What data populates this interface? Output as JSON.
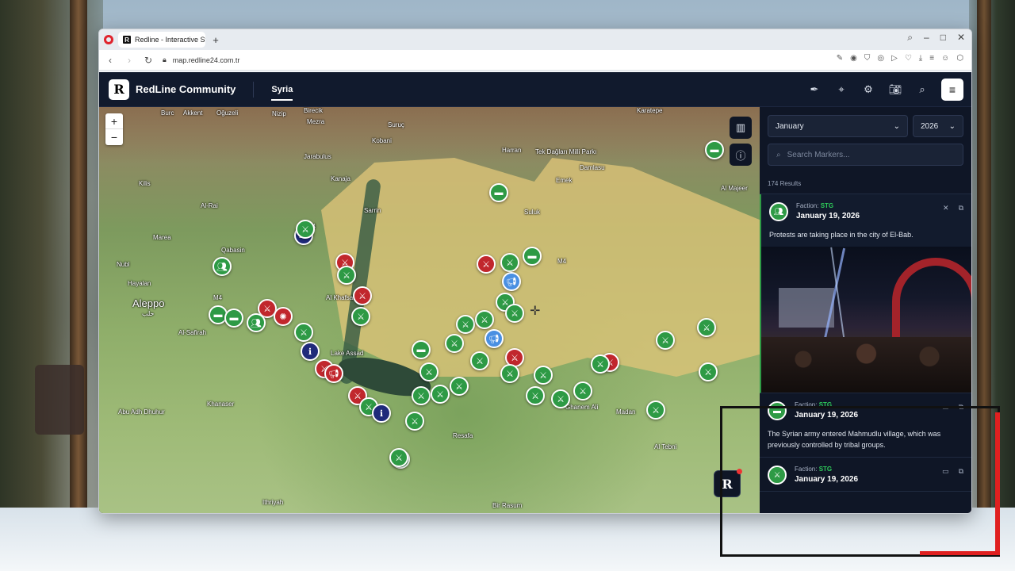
{
  "browser": {
    "tab_title": "Redline - Interactive Strat",
    "url": "map.redline24.com.tr"
  },
  "app": {
    "logo": "R",
    "title": "RedLine Community",
    "nav_tab": "Syria"
  },
  "map": {
    "zoom_in": "+",
    "zoom_out": "−",
    "places": {
      "aleppo": "Aleppo",
      "aleppo_ar": "حلب",
      "kobani": "Kobani",
      "suruc": "Suruç",
      "harran": "Harran",
      "tek_dagi": "Tek Dağları Milli Parkı",
      "damlasu": "Damlasu",
      "emek": "Emek",
      "karatepe": "Karatepe",
      "birecik": "Birecik",
      "nizip": "Nizip",
      "mezra": "Mezra",
      "akkent": "Akkent",
      "oguzeli": "Oğuzeli",
      "burc": "Burc",
      "jarabulus": "Jarabulus",
      "kanaja": "Kanaja",
      "sarrin": "Sarrin",
      "suluk": "Suluk",
      "al_majeer": "Al Majeer",
      "kilis": "Kilis",
      "al_rai": "Al-Rai",
      "marea": "Marea",
      "qabasin": "Qabasin",
      "nubl": "Nubl",
      "hayalan": "Hayalan",
      "al_khafsah": "Al Khafsah",
      "al_safirah": "Al-Safirah",
      "lake_assad": "Lake Assad",
      "khanaser": "Khanaser",
      "abu_adh_dhuhur": "Abu Adh Dhuhur",
      "resafa": "Resafa",
      "ghanem_ali": "Ghanem Ali",
      "madan": "Madan",
      "al_tebni": "Al Tebni",
      "ithriyah": "Ithriyah",
      "bir_rasum": "Bir Rasum",
      "m4": "M4"
    }
  },
  "sidebar": {
    "month": "January",
    "year": "2026",
    "search_placeholder": "Search Markers...",
    "results": "174 Results",
    "cards": [
      {
        "faction_label": "Faction:",
        "faction": "STG",
        "date": "January 19, 2026",
        "text": "Protests are taking place in the city of El-Bab."
      },
      {
        "faction_label": "Faction:",
        "faction": "STG",
        "date": "January 19, 2026",
        "text": "The Syrian army entered Mahmudlu village, which was previously controlled by tribal groups."
      },
      {
        "faction_label": "Faction:",
        "faction": "STG",
        "date": "January 19, 2026",
        "text": ""
      }
    ]
  },
  "colors": {
    "app_bg": "#0f1626",
    "faction_green": "#2e9a45",
    "hostile_red": "#c1272d",
    "navy": "#1f2a7a",
    "info_blue": "#4a90e2"
  }
}
